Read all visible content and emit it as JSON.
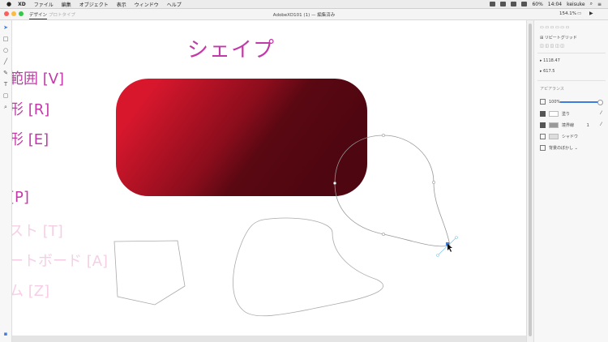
{
  "menubar": {
    "apple": "",
    "app_name": "XD",
    "items": [
      "ファイル",
      "編集",
      "オブジェクト",
      "表示",
      "ウィンドウ",
      "ヘルプ"
    ],
    "battery": "60%",
    "time": "14:04",
    "user": "keisuke"
  },
  "window": {
    "tab_design": "デザイン",
    "tab_prototype": "プロトタイプ",
    "doc_title": "AdobeXD101 (1) — 編集済み",
    "zoom": "154.1%"
  },
  "canvas": {
    "title": "シェイプ",
    "shortcuts": [
      {
        "text": "範囲 [V]",
        "style": "c1"
      },
      {
        "text": "形 [R]",
        "style": "c1"
      },
      {
        "text": "形 [E]",
        "style": "c1"
      },
      {
        "text": "[P]",
        "style": "c1"
      },
      {
        "text": "スト [T]",
        "style": "c2"
      },
      {
        "text": "ートボード [A]",
        "style": "c2"
      },
      {
        "text": "ム [Z]",
        "style": "c2"
      }
    ],
    "rect_gradient": {
      "start": "#d8172d",
      "end": "#4e0610"
    }
  },
  "panel": {
    "repeat_grid": "リピートグリッド",
    "x": "1118.47",
    "y": "617.5",
    "appearance": "アピアランス",
    "opacity": "100%",
    "fill": "塗り",
    "border": "境界線",
    "border_value": "1",
    "shadow": "シャドウ",
    "blur": "背景のぼかし"
  },
  "colors": {
    "accent_pink": "#c23aa8",
    "faded_pink": "#f6cfe6",
    "slider_blue": "#3f7ce0"
  }
}
